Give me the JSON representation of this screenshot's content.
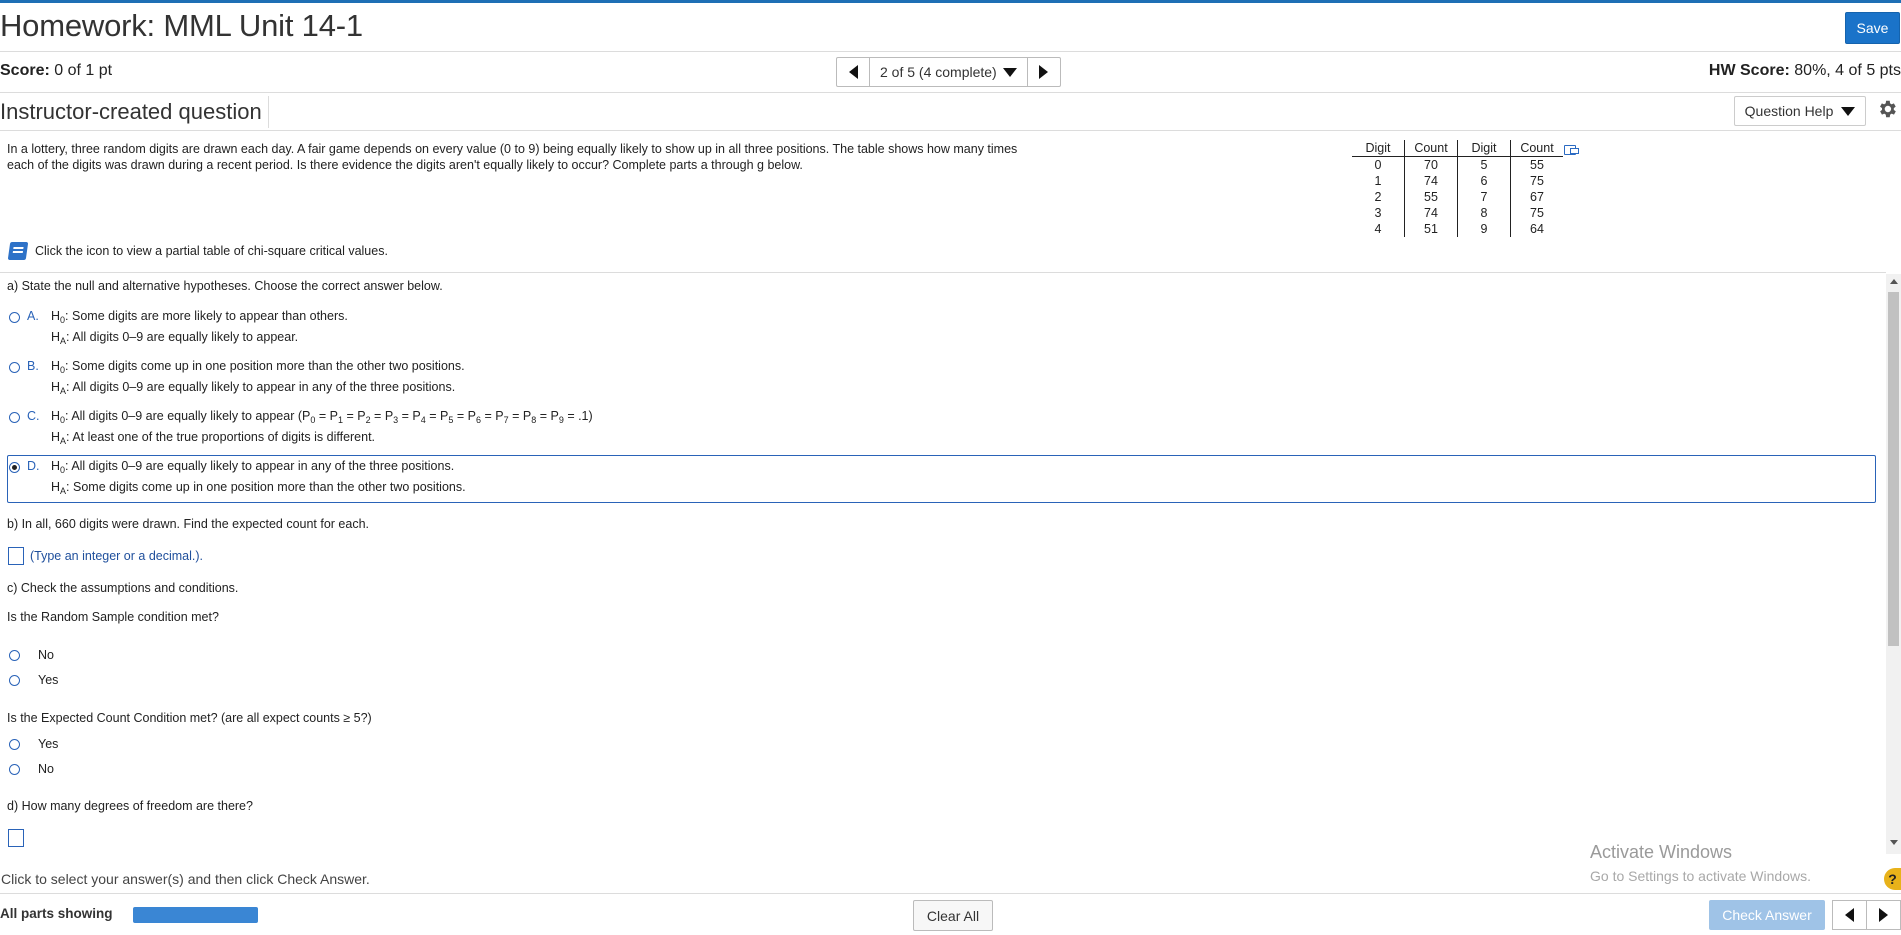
{
  "header": {
    "title": "Homework: MML Unit 14-1",
    "save_label": "Save",
    "score_label": "Score:",
    "score_value": "0 of 1 pt",
    "nav_text": "2 of 5 (4 complete)",
    "hw_score_label": "HW Score:",
    "hw_score_value": "80%, 4 of 5 pts"
  },
  "toolbar": {
    "question_type": "Instructor-created question",
    "help_label": "Question Help"
  },
  "problem": {
    "text": "In a lottery, three random digits are drawn each day. A fair game depends on every value (0 to 9) being equally likely to show up in all three positions. The table shows how many times each of the digits was drawn during a recent period. Is there evidence the digits aren't equally likely to occur? Complete parts a through g below.",
    "chi_link": "Click the icon to view a partial table of chi-square critical values."
  },
  "table": {
    "headers": [
      "Digit",
      "Count",
      "Digit",
      "Count"
    ],
    "rows": [
      [
        "0",
        "70",
        "5",
        "55"
      ],
      [
        "1",
        "74",
        "6",
        "75"
      ],
      [
        "2",
        "55",
        "7",
        "67"
      ],
      [
        "3",
        "74",
        "8",
        "75"
      ],
      [
        "4",
        "51",
        "9",
        "64"
      ]
    ]
  },
  "part_a": {
    "prompt": "a) State the null and alternative hypotheses. Choose the correct answer below.",
    "options": [
      {
        "letter": "A.",
        "h0": "Some digits are more likely to appear than others.",
        "ha": "All digits 0–9 are equally likely to appear."
      },
      {
        "letter": "B.",
        "h0": "Some digits come up in one position more than the other two positions.",
        "ha": "All digits 0–9 are equally likely to appear in any of the three positions."
      },
      {
        "letter": "C.",
        "h0": "All digits 0–9 are equally likely to appear (P",
        "ha": "At least one of the true proportions of digits is different."
      },
      {
        "letter": "D.",
        "h0": "All digits 0–9 are equally likely to appear in any of the three positions.",
        "ha": "Some digits come up in one position more than the other two positions."
      }
    ],
    "selected": "D"
  },
  "part_b": {
    "prompt": "b) In all, 660 digits were drawn. Find the expected count for each.",
    "hint": "(Type an integer or a decimal.)."
  },
  "part_c": {
    "prompt": "c) Check the assumptions and conditions.",
    "q1": "Is the Random Sample condition met?",
    "q1_options": [
      "No",
      "Yes"
    ],
    "q2": "Is the Expected Count Condition met? (are all expect counts  ≥  5?)",
    "q2_options": [
      "Yes",
      "No"
    ]
  },
  "part_d": {
    "prompt": "d) How many degrees of freedom are there?"
  },
  "footer": {
    "hint": "Click to select your answer(s) and then click Check Answer.",
    "all_parts": "All parts showing",
    "progress": 1.0,
    "clear_label": "Clear All",
    "check_label": "Check Answer"
  },
  "watermark": {
    "line1": "Activate Windows",
    "line2": "Go to Settings to activate Windows."
  },
  "colors": {
    "accent": "#1a73c9",
    "radio": "#2a63b8",
    "progress": "#3a86d4"
  }
}
